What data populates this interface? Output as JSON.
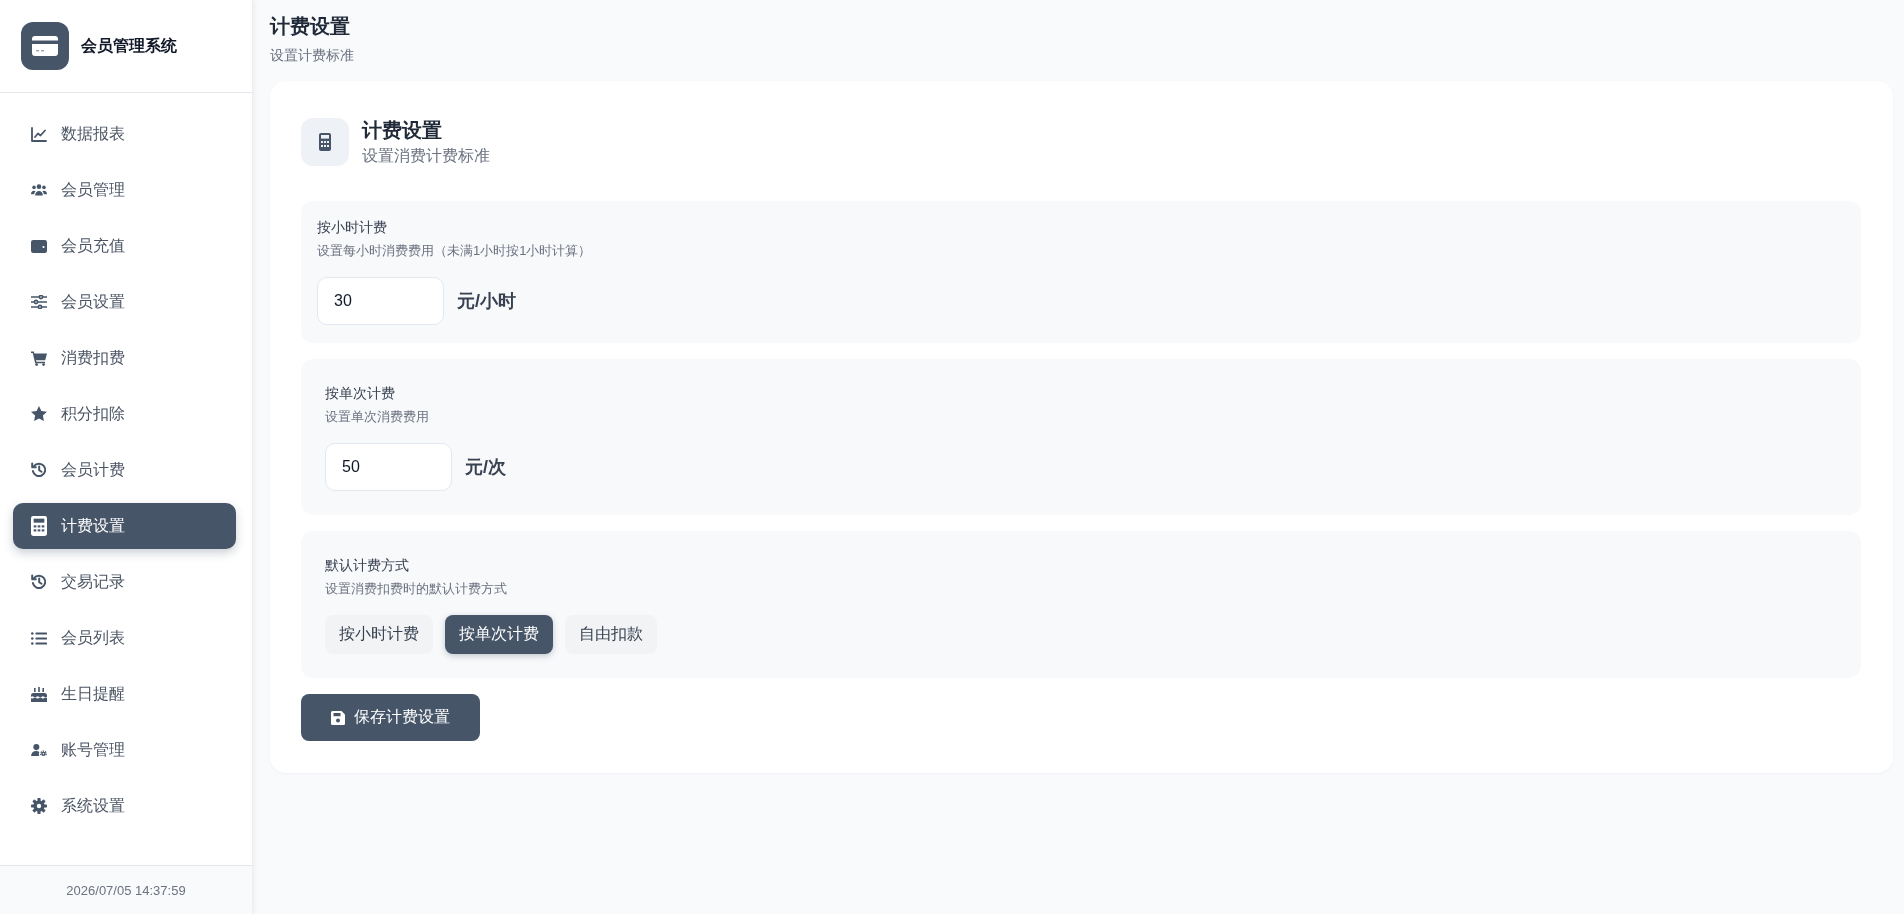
{
  "sidebar": {
    "brand": "会员管理系统",
    "nav_items": [
      {
        "label": "数据报表",
        "selected": false
      },
      {
        "label": "会员管理",
        "selected": false
      },
      {
        "label": "会员充值",
        "selected": false
      },
      {
        "label": "会员设置",
        "selected": false
      },
      {
        "label": "消费扣费",
        "selected": false
      },
      {
        "label": "积分扣除",
        "selected": false
      },
      {
        "label": "会员计费",
        "selected": false
      },
      {
        "label": "计费设置",
        "selected": true
      },
      {
        "label": "交易记录",
        "selected": false
      },
      {
        "label": "会员列表",
        "selected": false
      },
      {
        "label": "生日提醒",
        "selected": false
      },
      {
        "label": "账号管理",
        "selected": false
      },
      {
        "label": "系统设置",
        "selected": false
      }
    ],
    "footer_time": "2026/07/05 14:37:59"
  },
  "page_header": {
    "title": "计费设置",
    "subtitle": "设置计费标准"
  },
  "card": {
    "title": "计费设置",
    "subtitle": "设置消费计费标准",
    "sections": [
      {
        "kind": "price",
        "label": "按小时计费",
        "description": "设置每小时消费费用（未满1小时按1小时计算）",
        "value": "30",
        "unit": "元/小时"
      },
      {
        "kind": "price",
        "label": "按单次计费",
        "description": "设置单次消费费用",
        "value": "50",
        "unit": "元/次"
      },
      {
        "kind": "choice",
        "label": "默认计费方式",
        "description": "设置消费扣费时的默认计费方式",
        "options": [
          {
            "label": "按小时计费",
            "selected": false
          },
          {
            "label": "按单次计费",
            "selected": true
          },
          {
            "label": "自由扣款",
            "selected": false
          }
        ]
      }
    ],
    "save_button": "保存计费设置"
  }
}
